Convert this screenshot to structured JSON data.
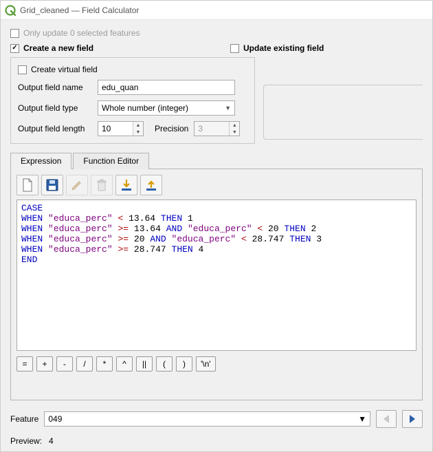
{
  "window": {
    "title": "Grid_cleaned — Field Calculator"
  },
  "only_update": {
    "label": "Only update 0 selected features",
    "checked": false
  },
  "create_new": {
    "label": "Create a new field",
    "checked": true
  },
  "update_existing": {
    "label": "Update existing field",
    "checked": false
  },
  "virtual_field": {
    "label": "Create virtual field",
    "checked": false
  },
  "output_name": {
    "label": "Output field name",
    "value": "edu_quan"
  },
  "output_type": {
    "label": "Output field type",
    "value": "Whole number (integer)"
  },
  "output_length": {
    "label": "Output field length",
    "value": "10"
  },
  "precision": {
    "label": "Precision",
    "value": "3"
  },
  "tabs": {
    "expression": "Expression",
    "function_editor": "Function Editor"
  },
  "toolbar": {
    "new": "new-file",
    "save": "save",
    "edit": "edit",
    "delete": "delete",
    "import": "import",
    "export": "export"
  },
  "expression": {
    "l1_kw": "CASE",
    "l2_kw1": "WHEN",
    "l2_s1": "\"educa_perc\"",
    "l2_op": "<",
    "l2_n1": "13.64",
    "l2_kw2": "THEN",
    "l2_n2": "1",
    "l3_kw1": "WHEN",
    "l3_s1": "\"educa_perc\"",
    "l3_op1": ">=",
    "l3_n1": "13.64",
    "l3_kw2": "AND",
    "l3_s2": "\"educa_perc\"",
    "l3_op2": "<",
    "l3_n2": "20",
    "l3_kw3": "THEN",
    "l3_n3": "2",
    "l4_kw1": "WHEN",
    "l4_s1": "\"educa_perc\"",
    "l4_op1": ">=",
    "l4_n1": "20",
    "l4_kw2": "AND",
    "l4_s2": "\"educa_perc\"",
    "l4_op2": "<",
    "l4_n2": "28.747",
    "l4_kw3": "THEN",
    "l4_n3": "3",
    "l5_kw1": "WHEN",
    "l5_s1": "\"educa_perc\"",
    "l5_op1": ">=",
    "l5_n1": "28.747",
    "l5_kw2": "THEN",
    "l5_n2": "4",
    "l6_kw": "END"
  },
  "operators": {
    "eq": "=",
    "plus": "+",
    "minus": "-",
    "div": "/",
    "mul": "*",
    "pow": "^",
    "concat": "||",
    "lparen": "(",
    "rparen": ")",
    "nl": "'\\n'"
  },
  "feature": {
    "label": "Feature",
    "value": "049"
  },
  "preview": {
    "label": "Preview:",
    "value": "4"
  }
}
